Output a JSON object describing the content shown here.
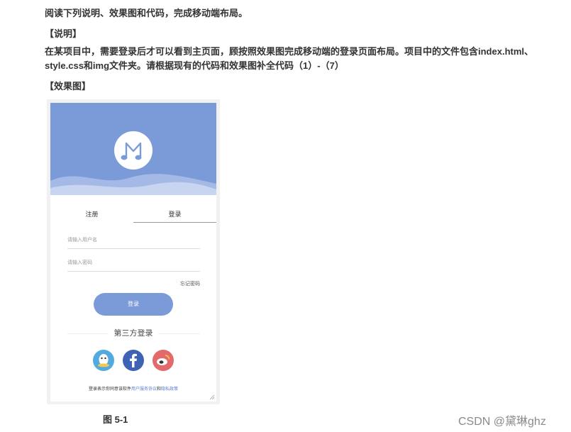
{
  "document": {
    "intro": "阅读下列说明、效果图和代码，完成移动端布局。",
    "heading_desc": "【说明】",
    "description": "在某项目中，需要登录后才可以看到主页面，顾按照效果图完成移动端的登录页面布局。项目中的文件包含index.html、style.css和img文件夹。请根据现有的代码和效果图补全代码（1）-（7）",
    "heading_fig": "【效果图】",
    "caption": "图 5-1",
    "watermark": "CSDN @黛琳ghz"
  },
  "login_screen": {
    "tab_register": "注册",
    "tab_login": "登录",
    "username_placeholder": "请输入用户名",
    "password_placeholder": "请输入密码",
    "forgot_password": "忘记密码",
    "login_button": "登录",
    "third_party_title": "第三方登录",
    "agree_prefix": "登录表示你同意该软件",
    "agree_link1": "用户服务协议",
    "agree_and": "和",
    "agree_link2": "隐私政策",
    "social_icons": [
      "qq-icon",
      "facebook-icon",
      "weibo-icon"
    ]
  },
  "colors": {
    "banner": "#7b9bd8",
    "button": "#7b9bd8",
    "qq": "#52aae0",
    "facebook": "#3f63b4",
    "weibo": "#e26a6a",
    "link": "#5b7fd2"
  }
}
